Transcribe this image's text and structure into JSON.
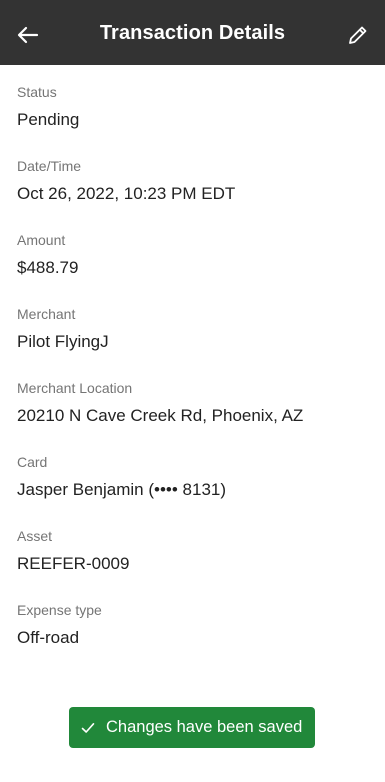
{
  "header": {
    "title": "Transaction Details",
    "back_icon": "arrow-left-icon",
    "edit_icon": "pencil-icon",
    "background": "#333333"
  },
  "fields": [
    {
      "label": "Status",
      "value": "Pending"
    },
    {
      "label": "Date/Time",
      "value": "Oct 26, 2022, 10:23 PM EDT"
    },
    {
      "label": "Amount",
      "value": "$488.79"
    },
    {
      "label": "Merchant",
      "value": "Pilot FlyingJ"
    },
    {
      "label": "Merchant Location",
      "value": "20210 N Cave Creek Rd, Phoenix, AZ"
    },
    {
      "label": "Card",
      "value": "Jasper Benjamin (•••• 8131)"
    },
    {
      "label": "Asset",
      "value": "REEFER-0009"
    },
    {
      "label": "Expense type",
      "value": "Off-road"
    }
  ],
  "toast": {
    "message": "Changes have been saved",
    "icon": "checkmark-icon",
    "color": "#21883a"
  }
}
